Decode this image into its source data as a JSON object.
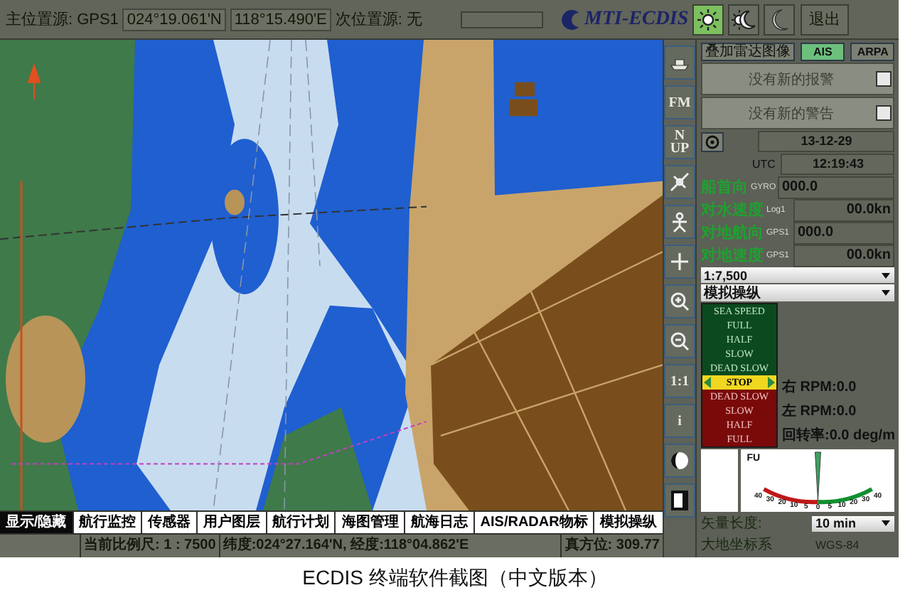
{
  "top_bar": {
    "primary_source_label": "主位置源:",
    "primary_source": "GPS1",
    "latitude": "024°19.061'N",
    "longitude": "118°15.490'E",
    "secondary_source": "次位置源: 无",
    "logo": "MTI-ECDIS",
    "display_modes": [
      {
        "kind": "day",
        "selected": true
      },
      {
        "kind": "dusk",
        "selected": false
      },
      {
        "kind": "night",
        "selected": false
      }
    ],
    "exit_button": "退出"
  },
  "toolbar": [
    {
      "kind": "ship"
    },
    {
      "kind": "text",
      "label": "FM"
    },
    {
      "kind": "text",
      "label": "N UP"
    },
    {
      "kind": "measure"
    },
    {
      "kind": "move"
    },
    {
      "kind": "cross"
    },
    {
      "kind": "zoom_in"
    },
    {
      "kind": "zoom_out"
    },
    {
      "kind": "text",
      "label": "1:1"
    },
    {
      "kind": "text",
      "label": "i"
    },
    {
      "kind": "contrast"
    },
    {
      "kind": "panel"
    }
  ],
  "overlay": {
    "radar_button": "叠加雷达图像",
    "targets": [
      {
        "label": "AIS",
        "selected": true
      },
      {
        "label": "ARPA",
        "selected": false
      }
    ]
  },
  "alarm_dropdown": "没有新的报警",
  "warning_dropdown": "没有新的警告",
  "date": "13-12-29",
  "utc_label": "UTC",
  "utc_time": "12:19:43",
  "readouts": [
    {
      "label": "船首向",
      "sensor": "GYRO",
      "value": "000.0",
      "kind": "angle"
    },
    {
      "label": "对水速度",
      "sensor": "Log1",
      "value": "00.0kn",
      "kind": "speed"
    },
    {
      "label": "对地航向",
      "sensor": "GPS1",
      "value": "000.0",
      "kind": "angle"
    },
    {
      "label": "对地速度",
      "sensor": "GPS1",
      "value": "00.0kn",
      "kind": "speed"
    }
  ],
  "scale_dropdown": "1:7,500",
  "mode_dropdown": "模拟操纵",
  "telegraph": [
    {
      "label": "SEA SPEED",
      "kind": "ahead",
      "selected": false
    },
    {
      "label": "FULL",
      "kind": "ahead",
      "selected": false
    },
    {
      "label": "HALF",
      "kind": "ahead",
      "selected": false
    },
    {
      "label": "SLOW",
      "kind": "ahead",
      "selected": false
    },
    {
      "label": "DEAD SLOW",
      "kind": "ahead",
      "selected": false
    },
    {
      "label": "STOP",
      "kind": "stop",
      "selected": true
    },
    {
      "label": "DEAD SLOW",
      "kind": "astern",
      "selected": false
    },
    {
      "label": "SLOW",
      "kind": "astern",
      "selected": false
    },
    {
      "label": "HALF",
      "kind": "astern",
      "selected": false
    },
    {
      "label": "FULL",
      "kind": "astern",
      "selected": false
    }
  ],
  "engine": [
    "右 RPM:0.0",
    "左 RPM:0.0",
    "回转率:0.0 deg/m"
  ],
  "rudder": {
    "mode": "FU",
    "scale": [
      "40",
      "30",
      "20",
      "10",
      "5",
      "0",
      "5",
      "10",
      "20",
      "30",
      "40"
    ]
  },
  "vector_length": {
    "label": "矢量长度:",
    "value": "10 min"
  },
  "datum": {
    "label": "大地坐标系",
    "value": "WGS-84"
  },
  "tabs": [
    {
      "label": "显示/隐藏",
      "selected": true
    },
    {
      "label": "航行监控",
      "selected": false
    },
    {
      "label": "传感器",
      "selected": false
    },
    {
      "label": "用户图层",
      "selected": false
    },
    {
      "label": "航行计划",
      "selected": false
    },
    {
      "label": "海图管理",
      "selected": false
    },
    {
      "label": "航海日志",
      "selected": false
    },
    {
      "label": "AIS/RADAR物标",
      "selected": false
    },
    {
      "label": "模拟操纵",
      "selected": false
    }
  ],
  "status_bar": {
    "scale": "当前比例尺: 1 : 7500",
    "position": "纬度:024°27.164'N, 经度:118°04.862'E",
    "bearing": "真方位: 309.77"
  },
  "caption": "ECDIS 终端软件截图（中文版本）"
}
